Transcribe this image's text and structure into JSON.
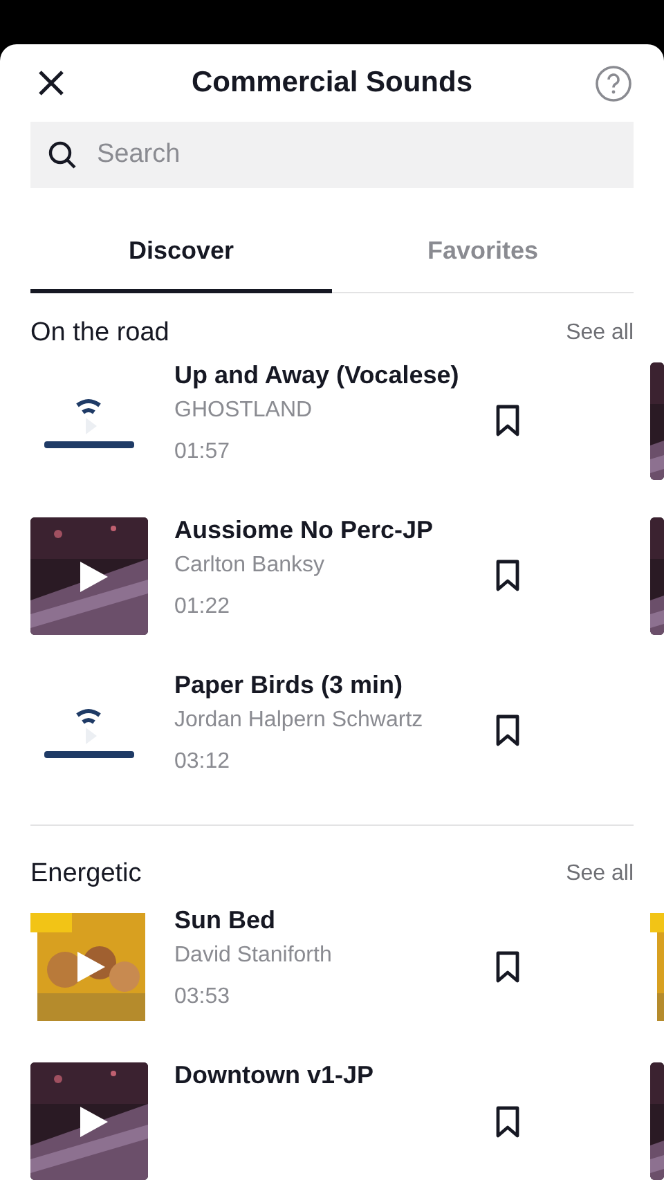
{
  "header": {
    "title": "Commercial Sounds"
  },
  "search": {
    "placeholder": "Search"
  },
  "tabs": [
    {
      "label": "Discover",
      "selected": true
    },
    {
      "label": "Favorites",
      "selected": false
    }
  ],
  "sections": [
    {
      "title": "On the road",
      "action": "See all",
      "tracks": [
        {
          "title": "Up and Away (Vocalese)",
          "artist": "GHOSTLAND",
          "duration": "01:57"
        },
        {
          "title": "Aussiome No Perc-JP",
          "artist": "Carlton Banksy",
          "duration": "01:22"
        },
        {
          "title": "Paper Birds (3 min)",
          "artist": "Jordan Halpern Schwartz",
          "duration": "03:12"
        }
      ]
    },
    {
      "title": "Energetic",
      "action": "See all",
      "tracks": [
        {
          "title": "Sun Bed",
          "artist": "David Staniforth",
          "duration": "03:53"
        },
        {
          "title": "Downtown v1-JP"
        }
      ]
    }
  ]
}
